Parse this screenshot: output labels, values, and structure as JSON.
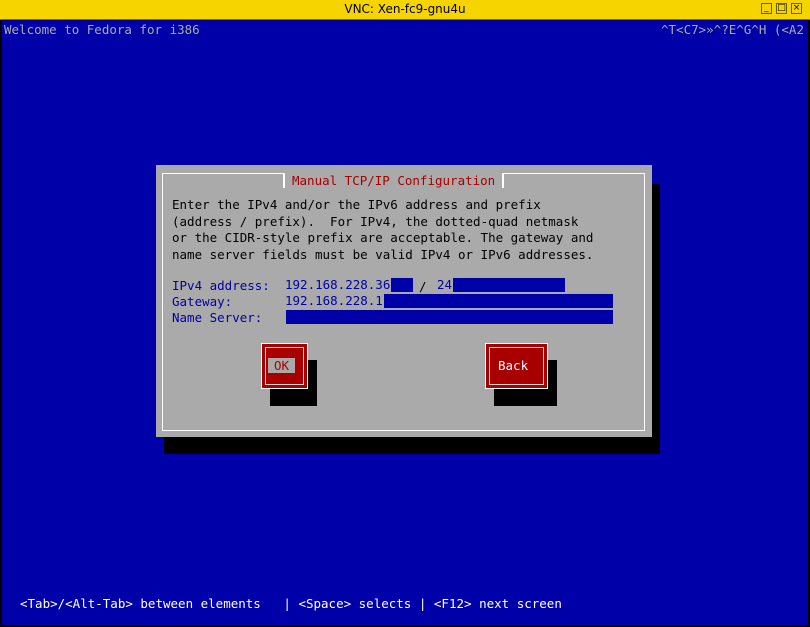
{
  "window": {
    "title": "VNC: Xen-fc9-gnu4u",
    "minimize_glyph": "_",
    "maximize_glyph": "□",
    "close_glyph": "×"
  },
  "console": {
    "header_left": "Welcome to Fedora for i386",
    "header_right": "^T<C7>»^?E^G^H (<A2",
    "status_line": "<Tab>/<Alt-Tab> between elements   | <Space> selects | <F12> next screen"
  },
  "dialog": {
    "title": "Manual TCP/IP Configuration",
    "description": [
      "Enter the IPv4 and/or the IPv6 address and prefix",
      "(address / prefix).  For IPv4, the dotted-quad netmask",
      "or the CIDR-style prefix are acceptable. The gateway and",
      "name server fields must be valid IPv4 or IPv6 addresses."
    ],
    "fields": {
      "ipv4_label": "IPv4 address:",
      "ipv4_value": "192.168.228.36",
      "prefix_separator": "/",
      "prefix_value": "24",
      "gateway_label": "Gateway:",
      "gateway_value": "192.168.228.1",
      "nameserver_label": "Name Server:",
      "nameserver_value": ""
    },
    "buttons": {
      "ok": "OK",
      "back": "Back"
    }
  },
  "colors": {
    "console_bg": "#0000a8",
    "dialog_bg": "#aaaaaa",
    "accent_red": "#a80000",
    "titlebar_yellow": "#f5d400"
  }
}
